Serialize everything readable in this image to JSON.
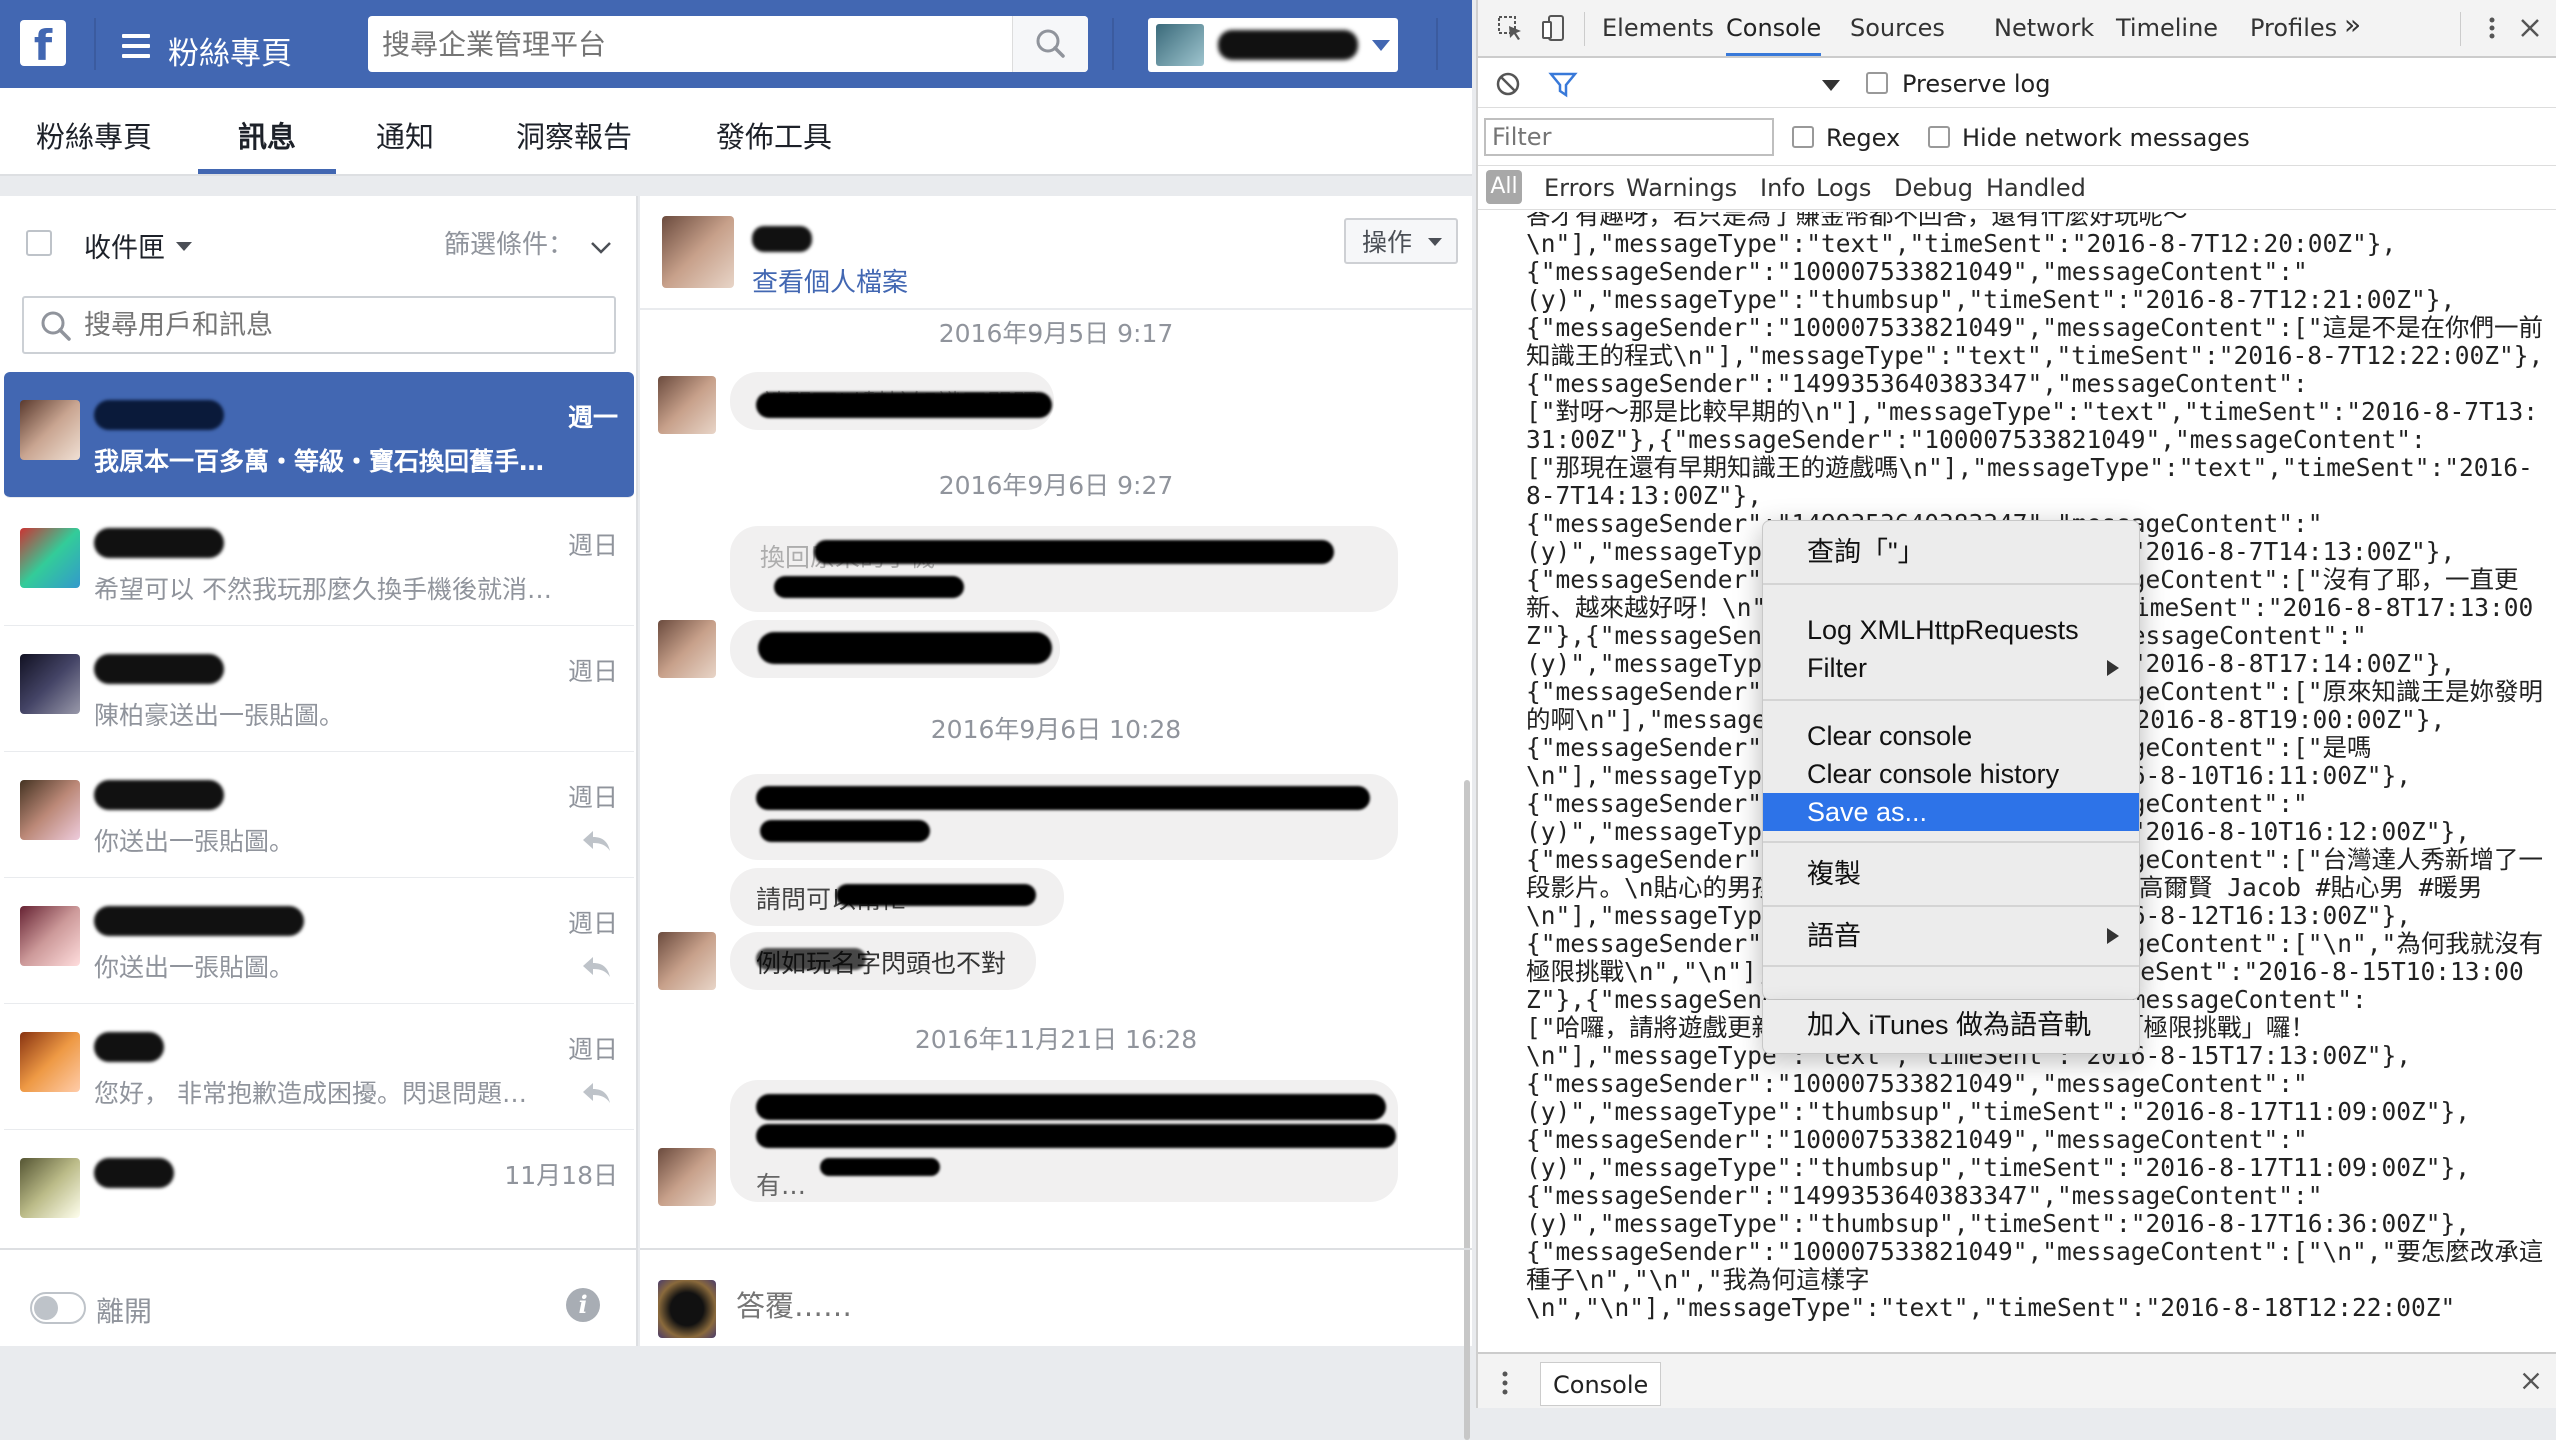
{
  "facebook": {
    "header": {
      "logo": "f",
      "page_title": "粉絲專頁",
      "search_placeholder": "搜尋企業管理平台"
    },
    "tabs": [
      "粉絲專頁",
      "訊息",
      "通知",
      "洞察報告",
      "發佈工具"
    ],
    "active_tab": "訊息",
    "inbox": {
      "label": "收件匣",
      "filter_label": "篩選條件：",
      "search_placeholder": "搜尋用戶和訊息",
      "threads": [
        {
          "snippet": "我原本一百多萬・等級・寶石換回舊手…",
          "time": "週一",
          "selected": true,
          "replied": false
        },
        {
          "snippet": "希望可以 不然我玩那麼久換手機後就消…",
          "time": "週日",
          "selected": false,
          "replied": false
        },
        {
          "snippet": "陳柏豪送出一張貼圖。",
          "time": "週日",
          "selected": false,
          "replied": false
        },
        {
          "snippet": "你送出一張貼圖。",
          "time": "週日",
          "selected": false,
          "replied": true
        },
        {
          "snippet": "你送出一張貼圖。",
          "time": "週日",
          "selected": false,
          "replied": true
        },
        {
          "snippet": "您好， 非常抱歉造成困擾。閃退問題…",
          "time": "週日",
          "selected": false,
          "replied": true
        },
        {
          "snippet": "",
          "time": "11月18日",
          "selected": false,
          "replied": false
        }
      ],
      "away_label": "離開"
    },
    "conversation": {
      "view_profile": "查看個人檔案",
      "action_button": "操作",
      "dates": [
        "2016年9月5日 9:17",
        "2016年9月6日 9:27",
        "2016年9月6日 10:28",
        "2016年11月21日 16:28"
      ],
      "visible_fragments": [
        "換回原來的手機",
        "請問可以幫忙知識王問題",
        "請問可以幫忙",
        "例如玩名字閃頭也不對",
        "有…"
      ],
      "reply_placeholder": "答覆……"
    }
  },
  "devtools": {
    "tabs": [
      "Elements",
      "Console",
      "Sources",
      "Network",
      "Timeline",
      "Profiles"
    ],
    "active_tab": "Console",
    "more_tabs": "»",
    "preserve_log": "Preserve log",
    "filter_placeholder": "Filter",
    "regex": "Regex",
    "hide_network": "Hide network messages",
    "levels": [
      "All",
      "Errors",
      "Warnings",
      "Info",
      "Logs",
      "Debug",
      "Handled"
    ],
    "console_text": "答才有趣呀，若只是為了賺金幣都不回答，還有什麼好玩呢～\n\\n\"],\"messageType\":\"text\",\"timeSent\":\"2016-8-7T12:20:00Z\"},\n{\"messageSender\":\"100007533821049\",\"messageContent\":\"\n(y)\",\"messageType\":\"thumbsup\",\"timeSent\":\"2016-8-7T12:21:00Z\"},\n{\"messageSender\":\"100007533821049\",\"messageContent\":[\"這是不是在你們一前知識王的程式\\n\"],\"messageType\":\"text\",\"timeSent\":\"2016-8-7T12:22:00Z\"},{\"messageSender\":\"1499353640383347\",\"messageContent\":\n[\"對呀～那是比較早期的\\n\"],\"messageType\":\"text\",\"timeSent\":\"2016-8-7T13:31:00Z\"},{\"messageSender\":\"100007533821049\",\"messageContent\":\n[\"那現在還有早期知識王的遊戲嗎\\n\"],\"messageType\":\"text\",\"timeSent\":\"2016-8-7T14:13:00Z\"},\n{\"messageSender\":\"1499353640383347\",\"messageContent\":\"\n(y)\",\"messageType\":\"thumbsup\",\"timeSent\":\"2016-8-7T14:13:00Z\"},\n{\"messageSender\":\"100007533821049\",\"messageContent\":[\"沒有了耶，一直更新、越來越好呀！\\n\"],\"messageType\":\"text\",\"timeSent\":\"2016-8-8T17:13:00Z\"},{\"messageSender\":\"100007533821049\",\"messageContent\":\"\n(y)\",\"messageType\":\"thumbsup\",\"timeSent\":\"2016-8-8T17:14:00Z\"},\n{\"messageSender\":\"100007533821049\",\"messageContent\":[\"原來知識王是妳發明的啊\\n\"],\"messageType\":\"text\",\"timeSent\":\"2016-8-8T19:00:00Z\"},\n{\"messageSender\":\"100007533821049\",\"messageContent\":[\"是嗎\n\\n\"],\"messageType\":\"text\",\"timeSent\":\"2016-8-10T16:11:00Z\"},\n{\"messageSender\":\"100007533821049\",\"messageContent\":\"\n(y)\",\"messageType\":\"thumbsup\",\"timeSent\":\"2016-8-10T16:12:00Z\"},\n{\"messageSender\":\"100007533821049\",\"messageContent\":[\"台灣達人秀新增了一段影片。\\n貼心的男孩(Jacob)台灣達人秀合作頻道： 高爾賢 Jacob #貼心男 #暖男\n\\n\"],\"messageType\":\"text\",\"timeSent\":\"2016-8-12T16:13:00Z\"},\n{\"messageSender\":\"100007533821049\",\"messageContent\":[\"\\n\",\"為何我就沒有極限挑戰\\n\",\"\\n\"],\"messageType\":\"text\",\"timeSent\":\"2016-8-15T10:13:00Z\"},{\"messageSender\":\"1499353640383347\",\"messageContent\":\n[\"哈囉，請將遊戲更新至最新版本，就會有新出的關卡「極限挑戰」囉！\n\\n\"],\"messageType\":\"text\",\"timeSent\":\"2016-8-15T17:13:00Z\"},\n{\"messageSender\":\"100007533821049\",\"messageContent\":\"\n(y)\",\"messageType\":\"thumbsup\",\"timeSent\":\"2016-8-17T11:09:00Z\"},\n{\"messageSender\":\"100007533821049\",\"messageContent\":\"\n(y)\",\"messageType\":\"thumbsup\",\"timeSent\":\"2016-8-17T11:09:00Z\"},\n{\"messageSender\":\"1499353640383347\",\"messageContent\":\"\n(y)\",\"messageType\":\"thumbsup\",\"timeSent\":\"2016-8-17T16:36:00Z\"},\n{\"messageSender\":\"100007533821049\",\"messageContent\":[\"\\n\",\"要怎麼改承這種子\\n\",\"\\n\",\"我為何這樣字\n\\n\",\"\\n\"],\"messageType\":\"text\",\"timeSent\":\"2016-8-18T12:22:00Z\"",
    "drawer_tab": "Console",
    "context_menu": {
      "items": [
        "查詢「\"」",
        "Log XMLHttpRequests",
        "Filter",
        "Clear console",
        "Clear console history",
        "Save as...",
        "複製",
        "語音",
        "加入 iTunes 做為語音軌"
      ],
      "highlighted": "Save as..."
    }
  }
}
